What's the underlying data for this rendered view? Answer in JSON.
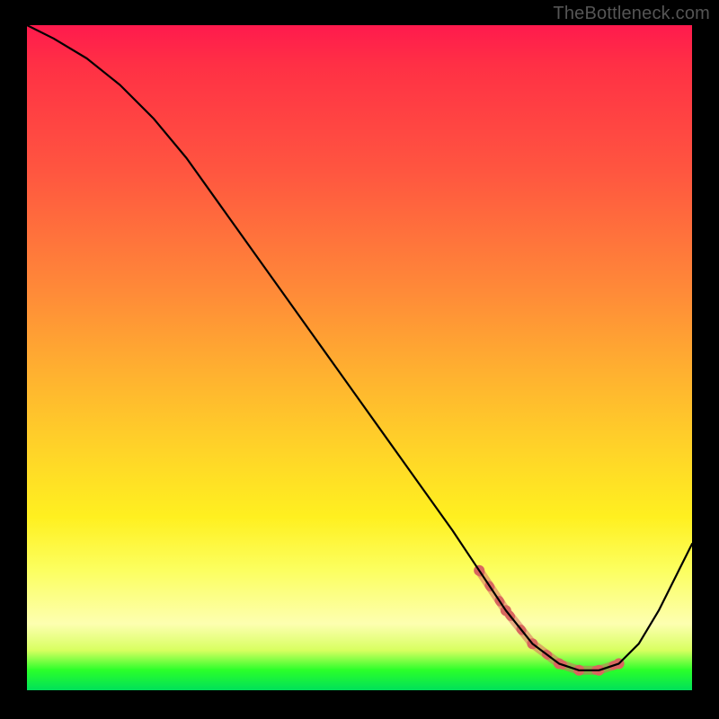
{
  "watermark": "TheBottleneck.com",
  "colors": {
    "background": "#000000",
    "curve": "#000000",
    "emphasis": "#d8675f",
    "gradient_top": "#ff1a4d",
    "gradient_bottom": "#00e05a"
  },
  "chart_data": {
    "type": "line",
    "title": "",
    "xlabel": "",
    "ylabel": "",
    "xlim": [
      0,
      100
    ],
    "ylim": [
      0,
      100
    ],
    "grid": false,
    "series": [
      {
        "name": "bottleneck-curve",
        "x": [
          0,
          4,
          9,
          14,
          19,
          24,
          29,
          34,
          39,
          44,
          49,
          54,
          59,
          64,
          68,
          72,
          76,
          80,
          83,
          86,
          89,
          92,
          95,
          98,
          100
        ],
        "values": [
          100,
          98,
          95,
          91,
          86,
          80,
          73,
          66,
          59,
          52,
          45,
          38,
          31,
          24,
          18,
          12,
          7,
          4,
          3,
          3,
          4,
          7,
          12,
          18,
          22
        ]
      }
    ],
    "emphasis_segment": {
      "name": "optimal-zone",
      "x": [
        68,
        72,
        76,
        80,
        83,
        86,
        89
      ],
      "values": [
        18,
        12,
        7,
        4,
        3,
        3,
        4
      ]
    }
  }
}
